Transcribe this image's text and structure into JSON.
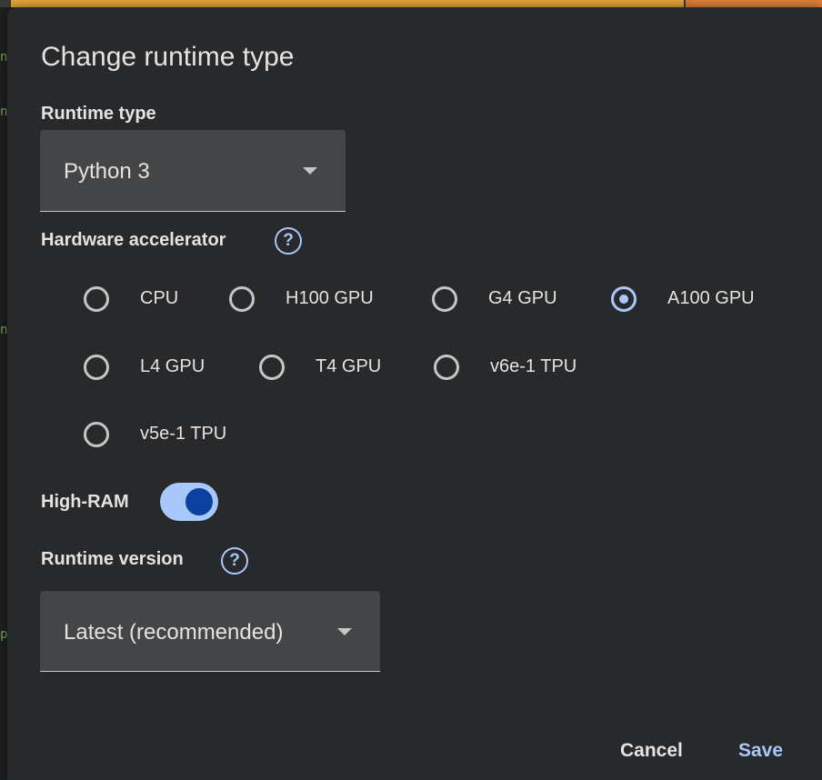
{
  "dialog": {
    "title": "Change runtime type",
    "runtime_type": {
      "label": "Runtime type",
      "value": "Python 3"
    },
    "hardware_accelerator": {
      "label": "Hardware accelerator",
      "options": [
        {
          "label": "CPU",
          "checked": false
        },
        {
          "label": "H100 GPU",
          "checked": false
        },
        {
          "label": "G4 GPU",
          "checked": false
        },
        {
          "label": "A100 GPU",
          "checked": true
        },
        {
          "label": "L4 GPU",
          "checked": false
        },
        {
          "label": "T4 GPU",
          "checked": false
        },
        {
          "label": "v6e-1 TPU",
          "checked": false
        },
        {
          "label": "v5e-1 TPU",
          "checked": false
        }
      ]
    },
    "high_ram": {
      "label": "High-RAM",
      "enabled": true
    },
    "runtime_version": {
      "label": "Runtime version",
      "value": "Latest (recommended)"
    },
    "buttons": {
      "cancel": "Cancel",
      "save": "Save"
    },
    "help_glyph": "?"
  },
  "icons": {
    "help": "question-circle-icon",
    "dropdown": "arrow-drop-down-icon"
  },
  "colors": {
    "accent": "#a8c7fa",
    "dialog_bg": "#28292b",
    "select_bg": "#444546",
    "text": "#e3e3e3",
    "toggle_knob": "#0b3fa0",
    "top_bar": "#e8a63a"
  }
}
